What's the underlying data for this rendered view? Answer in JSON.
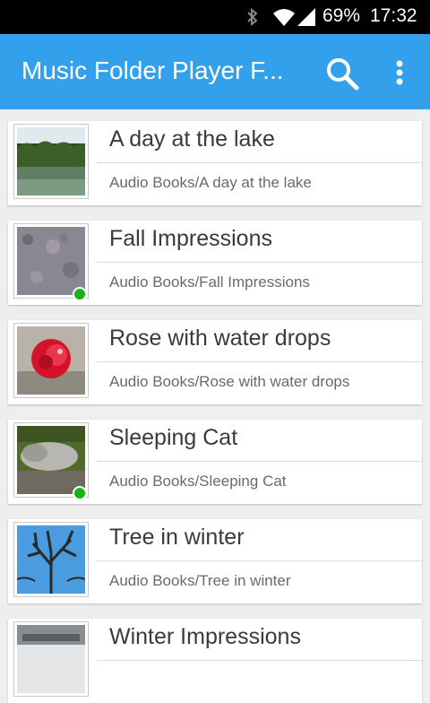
{
  "status_bar": {
    "battery": "69%",
    "time": "17:32"
  },
  "app_bar": {
    "title": "Music Folder Player F..."
  },
  "items": [
    {
      "name": "A day at the lake",
      "path": "Audio Books/A day at the lake"
    },
    {
      "name": "Fall Impressions",
      "path": "Audio Books/Fall Impressions"
    },
    {
      "name": "Rose with water drops",
      "path": "Audio Books/Rose with water drops"
    },
    {
      "name": "Sleeping Cat",
      "path": "Audio Books/Sleeping Cat"
    },
    {
      "name": "Tree in winter",
      "path": "Audio Books/Tree in winter"
    },
    {
      "name": "Winter Impressions",
      "path": ""
    }
  ],
  "colors": {
    "app_bar": "#33a0eb",
    "played_indicator": "#17b418",
    "background": "#eeeeee"
  }
}
